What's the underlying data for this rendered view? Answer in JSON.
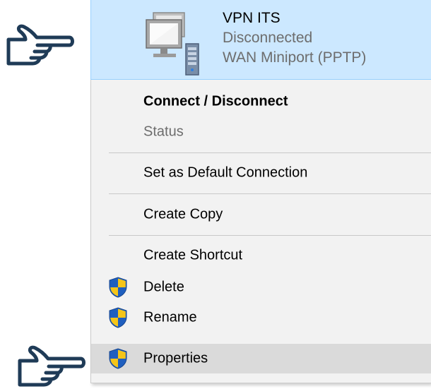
{
  "connection": {
    "name": "VPN ITS",
    "status": "Disconnected",
    "device": "WAN Miniport (PPTP)",
    "icon": "network-connection-icon"
  },
  "menu": {
    "items": [
      {
        "label": "Connect / Disconnect",
        "bold": true,
        "disabled": false,
        "shield": false,
        "highlighted": false
      },
      {
        "label": "Status",
        "bold": false,
        "disabled": true,
        "shield": false,
        "highlighted": false
      },
      {
        "label": "Set as Default Connection",
        "bold": false,
        "disabled": false,
        "shield": false,
        "highlighted": false
      },
      {
        "label": "Create Copy",
        "bold": false,
        "disabled": false,
        "shield": false,
        "highlighted": false
      },
      {
        "label": "Create Shortcut",
        "bold": false,
        "disabled": false,
        "shield": false,
        "highlighted": false
      },
      {
        "label": "Delete",
        "bold": false,
        "disabled": false,
        "shield": true,
        "highlighted": false
      },
      {
        "label": "Rename",
        "bold": false,
        "disabled": false,
        "shield": true,
        "highlighted": false
      },
      {
        "label": "Properties",
        "bold": false,
        "disabled": false,
        "shield": true,
        "highlighted": true
      }
    ]
  },
  "icons": {
    "shield": "uac-shield-icon",
    "hand": "pointing-hand-icon"
  },
  "colors": {
    "selection_blue": "#cce8ff",
    "selection_border": "#99d1ff",
    "menu_background": "#f2f2f2",
    "menu_highlight": "#dadada",
    "disabled_text": "#6d6d6d",
    "hand_outline": "#1f3b57",
    "shield_blue": "#1f5fbf",
    "shield_yellow": "#f5c518"
  }
}
